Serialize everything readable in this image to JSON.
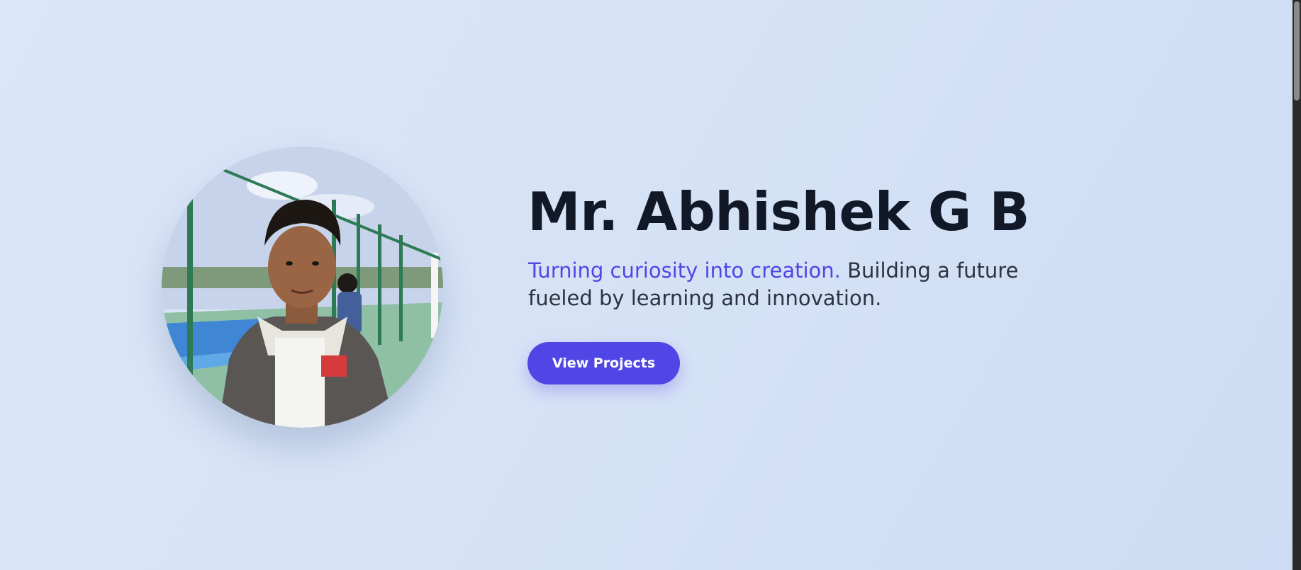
{
  "hero": {
    "name": "Mr. Abhishek G B",
    "tagline_accent": "Turning curiosity into creation.",
    "tagline_rest": " Building a future fueled by learning and innovation.",
    "cta_label": "View Projects"
  },
  "colors": {
    "accent": "#4f46e5",
    "heading": "#111827",
    "body_text": "#2d3340",
    "background": "#d8e4f7"
  },
  "icons": {
    "profile_photo": "profile-photo"
  }
}
